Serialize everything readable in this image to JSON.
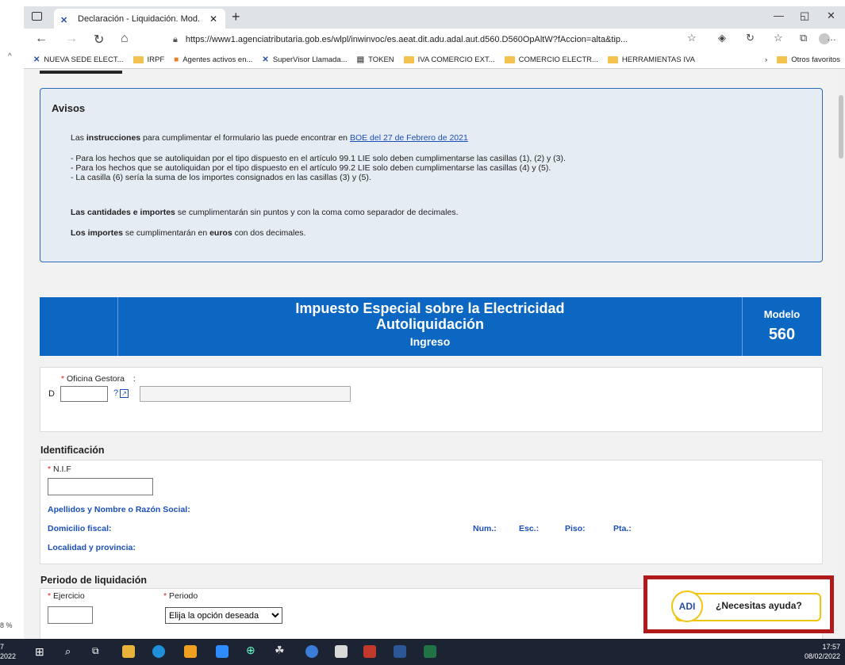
{
  "browser": {
    "tab_title": "Declaración - Liquidación. Mod.",
    "url": "https://www1.agenciatributaria.gob.es/wlpl/inwinvoc/es.aeat.dit.adu.adal.aut.d560.D560OpAltW?fAccion=alta&tip...",
    "bookmarks": [
      {
        "label": "NUEVA SEDE ELECT...",
        "icon": "aeat-icon"
      },
      {
        "label": "IRPF",
        "icon": "folder-icon"
      },
      {
        "label": "Agentes activos en...",
        "icon": "app-icon"
      },
      {
        "label": "SuperVisor Llamada...",
        "icon": "aeat-icon"
      },
      {
        "label": "TOKEN",
        "icon": "page-icon"
      },
      {
        "label": "IVA COMERCIO EXT...",
        "icon": "folder-icon"
      },
      {
        "label": "COMERCIO ELECTR...",
        "icon": "folder-icon"
      },
      {
        "label": "HERRAMIENTAS IVA",
        "icon": "folder-icon"
      }
    ],
    "other_favorites": "Otros favoritos"
  },
  "avisos": {
    "title": "Avisos",
    "line1_pre": "Las ",
    "line1_bold": "instrucciones",
    "line1_mid": " para cumplimentar el formulario las puede encontrar en ",
    "line1_link": "BOE del 27 de Febrero de 2021",
    "bullet1": "- Para los hechos que se autoliquidan por el tipo dispuesto en el artículo 99.1 LIE solo deben cumplimentarse las casillas (1), (2) y (3).",
    "bullet2": "- Para los hechos que se autoliquidan por el tipo dispuesto en el artículo 99.2 LIE solo deben cumplimentarse las casillas (4) y (5).",
    "bullet3": "- La casilla (6) sería la suma de los importes consignados en las casillas (3) y (5).",
    "cant_bold": "Las cantidades e importes",
    "cant_rest": " se cumplimentarán sin puntos y con la coma como separador de decimales.",
    "imp_bold1": "Los importes",
    "imp_mid": " se cumplimentarán en ",
    "imp_bold2": "euros",
    "imp_rest": " con dos decimales."
  },
  "banner": {
    "title1": "Impuesto Especial sobre la Electricidad",
    "title2": "Autoliquidación",
    "title3": "Ingreso",
    "modelo_label": "Modelo",
    "modelo_num": "560"
  },
  "oficina": {
    "label": "Oficina Gestora",
    "colon": ":",
    "prefix": "D",
    "help": "?"
  },
  "identificacion": {
    "title": "Identificación",
    "nif_label": "N.I.F",
    "apellidos": "Apellidos y Nombre o Razón Social:",
    "domicilio": "Domicilio fiscal:",
    "num": "Num.:",
    "esc": "Esc.:",
    "piso": "Piso:",
    "pta": "Pta.:",
    "localidad": "Localidad y provincia:"
  },
  "periodo": {
    "title": "Periodo de liquidación",
    "ejercicio": "Ejercicio",
    "periodo": "Periodo",
    "select_value": "Elija la opción deseada"
  },
  "help": {
    "logo": "ADI",
    "text": "¿Necesitas ayuda?"
  },
  "taskbar": {
    "time": "17:57",
    "date": "08/02/2022",
    "left_time": "7",
    "left_date": "2022",
    "zoom": "8 %"
  },
  "colors": {
    "banner": "#0c67c2",
    "avisos_bg": "#e6ecf3",
    "highlight": "#b01a1a",
    "help_border": "#f1c40f"
  }
}
